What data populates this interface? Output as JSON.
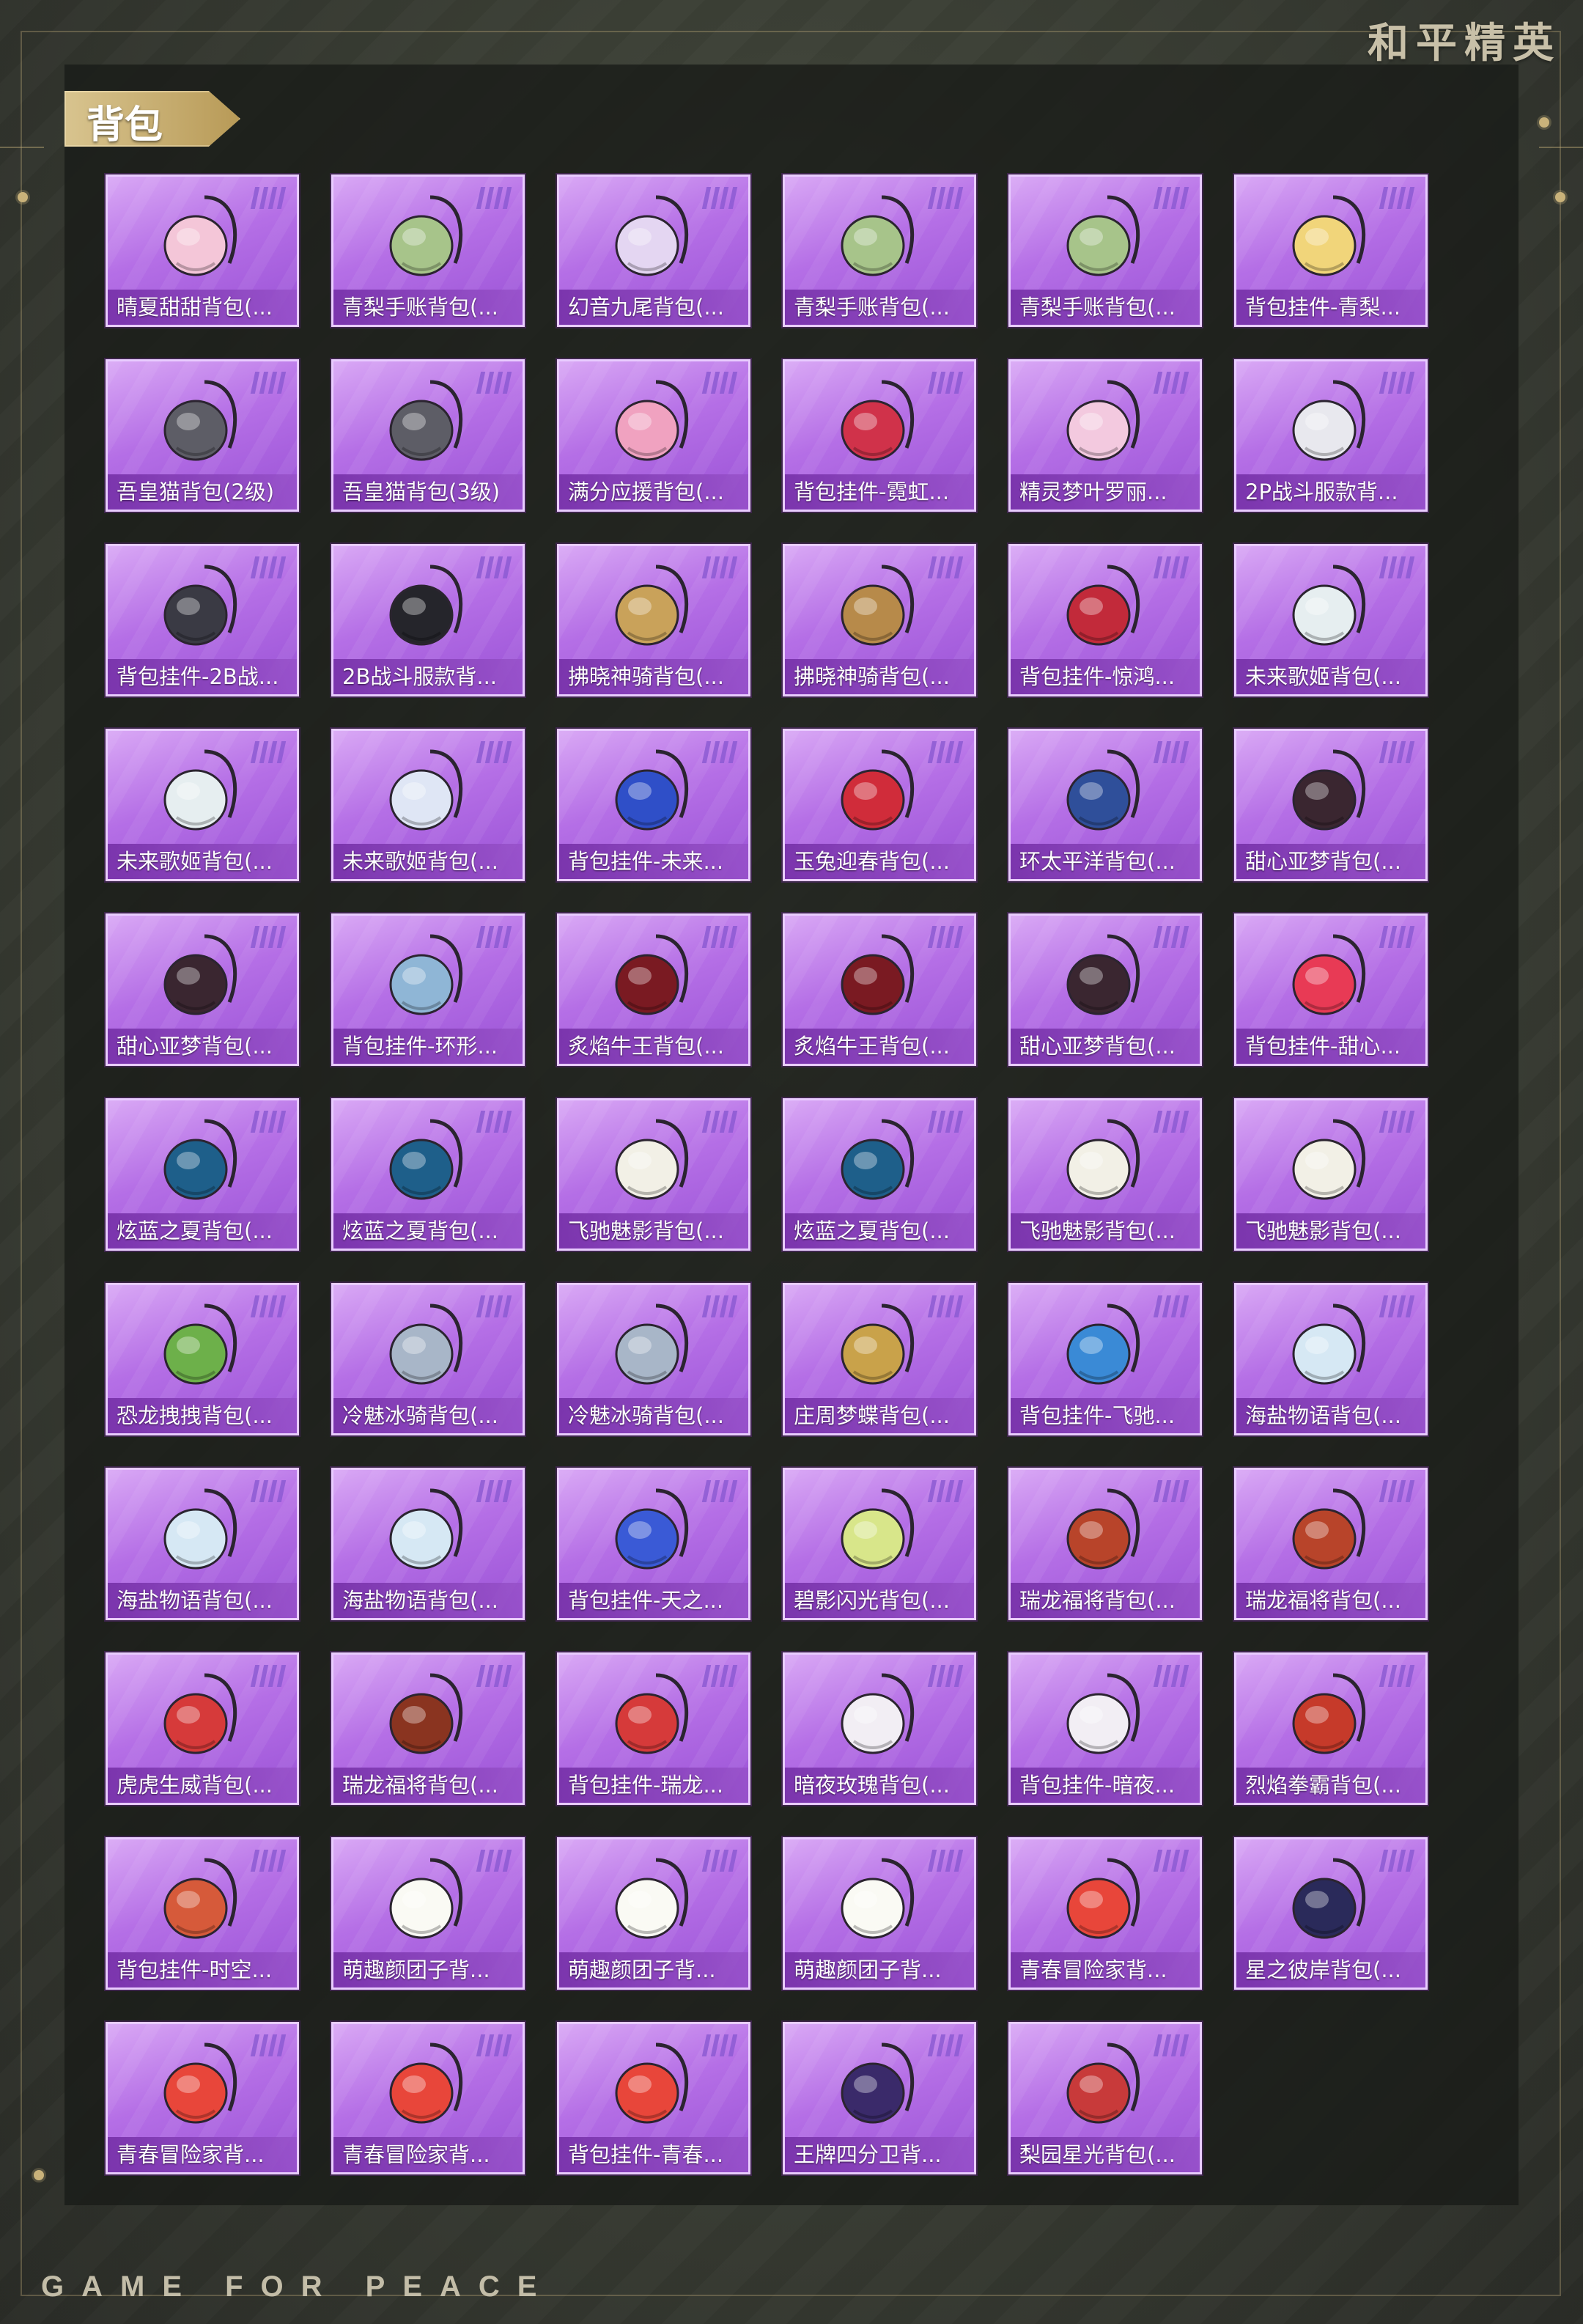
{
  "brand": "和平精英",
  "footer_brand": "GAME FOR PEACE",
  "section": {
    "title": "背包"
  },
  "items": [
    {
      "label": "晴夏甜甜背包(...",
      "icon": "pink-bunny-backpack-icon",
      "color": "#f4c6d8"
    },
    {
      "label": "青梨手账背包(...",
      "icon": "green-pear-backpack-icon",
      "color": "#a7c48a"
    },
    {
      "label": "幻音九尾背包(...",
      "icon": "crystal-backpack-icon",
      "color": "#e4d6f2"
    },
    {
      "label": "青梨手账背包(...",
      "icon": "green-pear-backpack-icon",
      "color": "#a7c48a"
    },
    {
      "label": "青梨手账背包(...",
      "icon": "green-pear-backpack-icon",
      "color": "#a7c48a"
    },
    {
      "label": "背包挂件-青梨...",
      "icon": "pear-charm-icon",
      "color": "#f1d57a"
    },
    {
      "label": "吾皇猫背包(2级)",
      "icon": "cat-backpack-icon",
      "color": "#5d5d66"
    },
    {
      "label": "吾皇猫背包(3级)",
      "icon": "cat-backpack-icon",
      "color": "#5d5d66"
    },
    {
      "label": "满分应援背包(...",
      "icon": "cheer-backpack-icon",
      "color": "#f0a2c0"
    },
    {
      "label": "背包挂件-霓虹...",
      "icon": "neon-charm-icon",
      "color": "#d0324a"
    },
    {
      "label": "精灵梦叶罗丽...",
      "icon": "fairy-backpack-icon",
      "color": "#f3c9df"
    },
    {
      "label": "2P战斗服款背...",
      "icon": "white-backpack-icon",
      "color": "#e8e8ee"
    },
    {
      "label": "背包挂件-2B战...",
      "icon": "sword-charm-icon",
      "color": "#3a3a44"
    },
    {
      "label": "2B战斗服款背...",
      "icon": "black-backpack-icon",
      "color": "#25252b"
    },
    {
      "label": "拂晓神骑背包(...",
      "icon": "golden-armor-backpack-icon",
      "color": "#c9a25a"
    },
    {
      "label": "拂晓神骑背包(...",
      "icon": "golden-armor-backpack-icon",
      "color": "#b78a4a"
    },
    {
      "label": "背包挂件-惊鸿...",
      "icon": "tassel-charm-icon",
      "color": "#c22a3a"
    },
    {
      "label": "未来歌姬背包(...",
      "icon": "idol-backpack-icon",
      "color": "#e6eef0"
    },
    {
      "label": "未来歌姬背包(...",
      "icon": "idol-backpack-icon",
      "color": "#e6eef0"
    },
    {
      "label": "未来歌姬背包(...",
      "icon": "idol-wing-backpack-icon",
      "color": "#dfe6f5"
    },
    {
      "label": "背包挂件-未来...",
      "icon": "heart-charm-icon",
      "color": "#2f4fc8"
    },
    {
      "label": "玉兔迎春背包(...",
      "icon": "red-backpack-icon",
      "color": "#d02c3a"
    },
    {
      "label": "环太平洋背包(...",
      "icon": "mech-backpack-icon",
      "color": "#2f4f9a"
    },
    {
      "label": "甜心亚梦背包(...",
      "icon": "dark-red-backpack-icon",
      "color": "#3a2630"
    },
    {
      "label": "甜心亚梦背包(...",
      "icon": "dark-red-backpack-icon",
      "color": "#3a2630"
    },
    {
      "label": "背包挂件-环形...",
      "icon": "ring-charm-icon",
      "color": "#8fb6d6"
    },
    {
      "label": "炙焰牛王背包(...",
      "icon": "flame-bull-backpack-icon",
      "color": "#7a1a22"
    },
    {
      "label": "炙焰牛王背包(...",
      "icon": "flame-bull-backpack-icon",
      "color": "#7a1a22"
    },
    {
      "label": "甜心亚梦背包(...",
      "icon": "dark-red-backpack-icon",
      "color": "#3a2630"
    },
    {
      "label": "背包挂件-甜心...",
      "icon": "paw-charm-icon",
      "color": "#e83a55"
    },
    {
      "label": "炫蓝之夏背包(...",
      "icon": "blue-backpack-icon",
      "color": "#1e5f8a"
    },
    {
      "label": "炫蓝之夏背包(...",
      "icon": "blue-backpack-icon",
      "color": "#1e5f8a"
    },
    {
      "label": "飞驰魅影背包(...",
      "icon": "white-gold-backpack-icon",
      "color": "#f2f0e6"
    },
    {
      "label": "炫蓝之夏背包(...",
      "icon": "blue-backpack-icon",
      "color": "#1e5f8a"
    },
    {
      "label": "飞驰魅影背包(...",
      "icon": "white-gold-backpack-icon",
      "color": "#f2f0e6"
    },
    {
      "label": "飞驰魅影背包(...",
      "icon": "white-gold-backpack-icon",
      "color": "#f2f0e6"
    },
    {
      "label": "恐龙拽拽背包(...",
      "icon": "dino-backpack-icon",
      "color": "#6db04a"
    },
    {
      "label": "冷魅冰骑背包(...",
      "icon": "ice-knight-backpack-icon",
      "color": "#a8b6c8"
    },
    {
      "label": "冷魅冰骑背包(...",
      "icon": "ice-knight-backpack-icon",
      "color": "#a8b6c8"
    },
    {
      "label": "庄周梦蝶背包(...",
      "icon": "butterfly-backpack-icon",
      "color": "#c9a24a"
    },
    {
      "label": "背包挂件-飞驰...",
      "icon": "eye-charm-icon",
      "color": "#3a8ad6"
    },
    {
      "label": "海盐物语背包(...",
      "icon": "sea-salt-backpack-icon",
      "color": "#d6e8f4"
    },
    {
      "label": "海盐物语背包(...",
      "icon": "sea-salt-backpack-icon",
      "color": "#d6e8f4"
    },
    {
      "label": "海盐物语背包(...",
      "icon": "sea-salt-backpack-icon",
      "color": "#d6e8f4"
    },
    {
      "label": "背包挂件-天之...",
      "icon": "wand-charm-icon",
      "color": "#3a5ad6"
    },
    {
      "label": "碧影闪光背包(...",
      "icon": "green-flash-backpack-icon",
      "color": "#d8e68a"
    },
    {
      "label": "瑞龙福将背包(...",
      "icon": "dragon-backpack-icon",
      "color": "#b8442a"
    },
    {
      "label": "瑞龙福将背包(...",
      "icon": "dragon-backpack-icon",
      "color": "#b8442a"
    },
    {
      "label": "虎虎生威背包(...",
      "icon": "tiger-backpack-icon",
      "color": "#d63a3a"
    },
    {
      "label": "瑞龙福将背包(...",
      "icon": "dragon-backpack-icon",
      "color": "#8a3420"
    },
    {
      "label": "背包挂件-瑞龙...",
      "icon": "dragon-charm-icon",
      "color": "#d63a3a"
    },
    {
      "label": "暗夜玫瑰背包(...",
      "icon": "rose-bunny-backpack-icon",
      "color": "#f2eef4"
    },
    {
      "label": "背包挂件-暗夜...",
      "icon": "bunny-charm-icon",
      "color": "#f2eef4"
    },
    {
      "label": "烈焰拳霸背包(...",
      "icon": "fire-fist-backpack-icon",
      "color": "#c63a2a"
    },
    {
      "label": "背包挂件-时空...",
      "icon": "crown-charm-icon",
      "color": "#d65a3a"
    },
    {
      "label": "萌趣颜团子背...",
      "icon": "dumpling-backpack-icon",
      "color": "#fafaf4"
    },
    {
      "label": "萌趣颜团子背...",
      "icon": "dumpling-backpack-icon",
      "color": "#fafaf4"
    },
    {
      "label": "萌趣颜团子背...",
      "icon": "dumpling-backpack-icon",
      "color": "#fafaf4"
    },
    {
      "label": "青春冒险家背...",
      "icon": "red-adventure-backpack-icon",
      "color": "#e8463a"
    },
    {
      "label": "星之彼岸背包(...",
      "icon": "star-backpack-icon",
      "color": "#2a2a5a"
    },
    {
      "label": "青春冒险家背...",
      "icon": "red-adventure-backpack-icon",
      "color": "#e8463a"
    },
    {
      "label": "青春冒险家背...",
      "icon": "red-adventure-backpack-icon",
      "color": "#e8463a"
    },
    {
      "label": "背包挂件-青春...",
      "icon": "dragon-charm-icon",
      "color": "#e8463a"
    },
    {
      "label": "王牌四分卫背...",
      "icon": "quarterback-backpack-icon",
      "color": "#3a2a6a"
    },
    {
      "label": "梨园星光背包(...",
      "icon": "opera-backpack-icon",
      "color": "#c83a3a"
    }
  ]
}
